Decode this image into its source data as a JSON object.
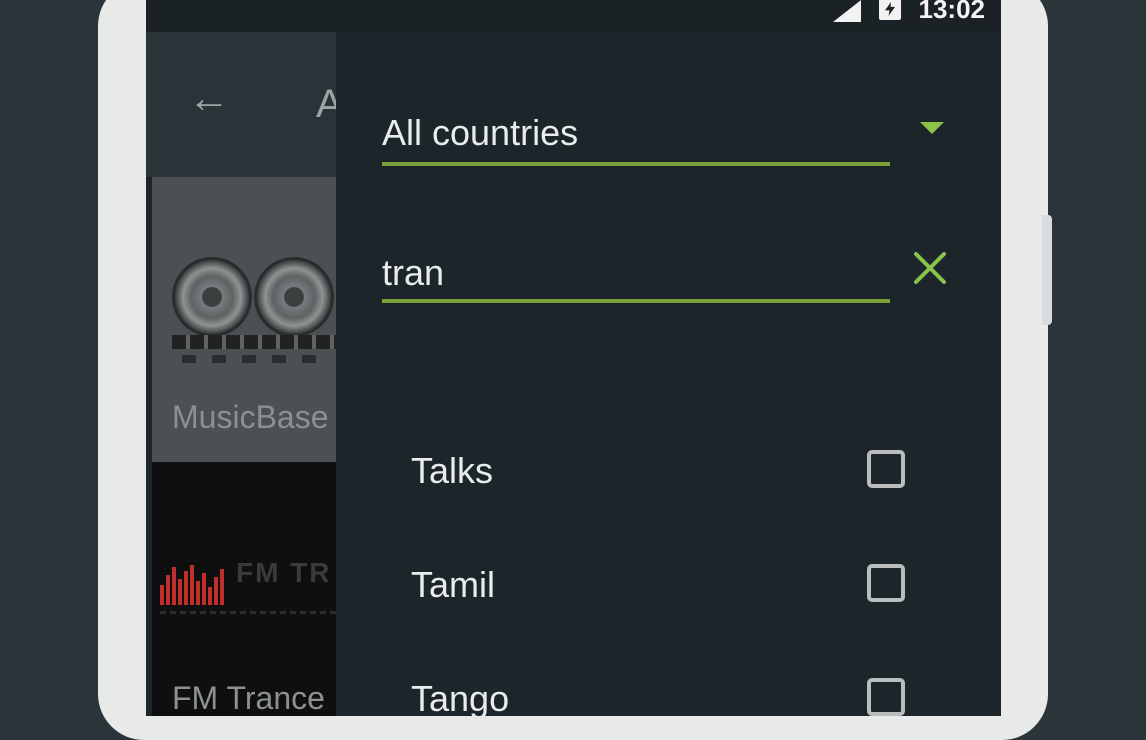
{
  "status_bar": {
    "time": "13:02"
  },
  "background_screen": {
    "title_fragment": "A",
    "stations": [
      {
        "name": "MusicBase"
      },
      {
        "name": "FM Trance",
        "logo_text": "FM TR"
      }
    ]
  },
  "filter_drawer": {
    "country": {
      "value": "All countries"
    },
    "search": {
      "value": "tran"
    },
    "genres": [
      {
        "label": "Talks",
        "checked": false
      },
      {
        "label": "Tamil",
        "checked": false
      },
      {
        "label": "Tango",
        "checked": false
      }
    ]
  },
  "colors": {
    "accent": "#8bc34a",
    "drawer_bg": "#1c2529",
    "text": "#e9ecec",
    "checkbox_border": "#b9bdbe"
  },
  "icons": [
    "back-arrow-icon",
    "signal-icon",
    "battery-charging-icon",
    "dropdown-arrow-icon",
    "clear-icon",
    "checkbox-icon"
  ]
}
